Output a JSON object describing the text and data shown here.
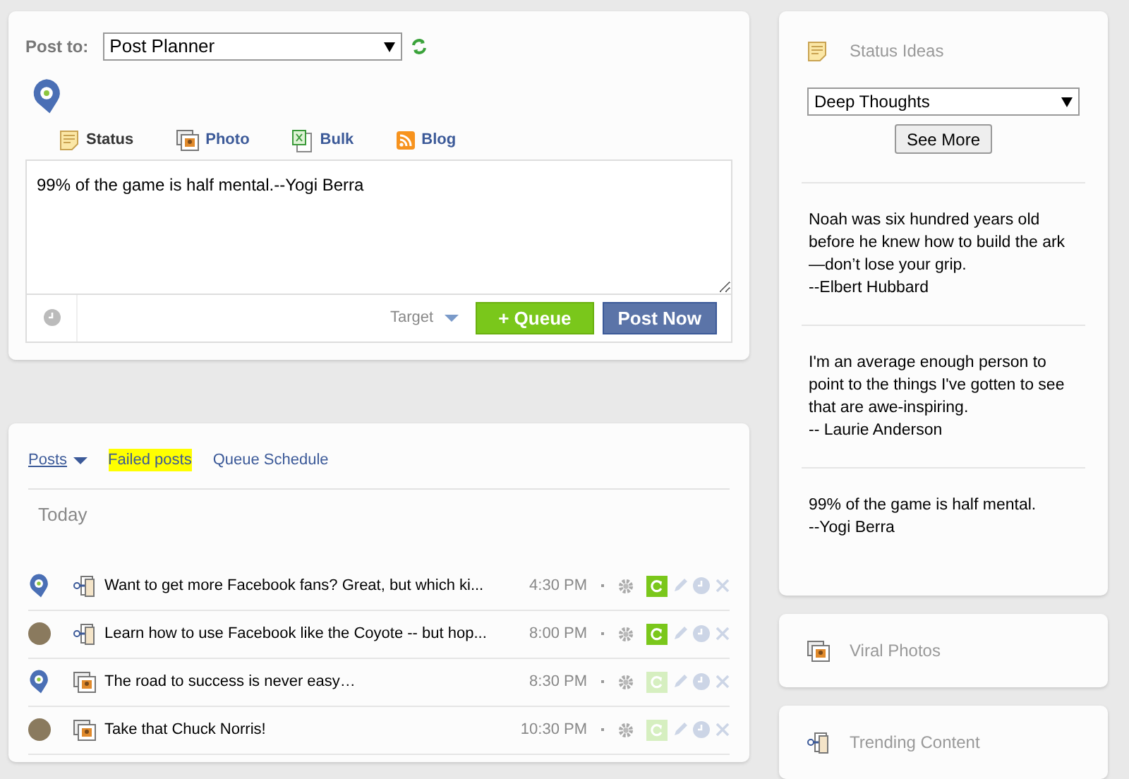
{
  "composer": {
    "post_to_label": "Post to:",
    "post_to_value": "Post Planner",
    "tabs": [
      {
        "label": "Status",
        "kind": "status",
        "selected": true
      },
      {
        "label": "Photo",
        "kind": "photo",
        "selected": false
      },
      {
        "label": "Bulk",
        "kind": "bulk",
        "selected": false
      },
      {
        "label": "Blog",
        "kind": "blog",
        "selected": false
      }
    ],
    "message": "99% of the game is half mental.--Yogi Berra",
    "target_label": "Target",
    "queue_button": "+ Queue",
    "post_now_button": "Post Now"
  },
  "posts": {
    "tabs": [
      {
        "label": "Posts",
        "kind": "dropdown",
        "selected": true
      },
      {
        "label": "Failed posts",
        "kind": "highlight",
        "selected": false
      },
      {
        "label": "Queue Schedule",
        "kind": "plain",
        "selected": false
      }
    ],
    "day": "Today",
    "rows": [
      {
        "logo_avatar": true,
        "kind": "link",
        "text": "Want to get more Facebook fans? Great, but which ki...",
        "time": "4:30 PM",
        "recycle_on": true
      },
      {
        "logo_avatar": false,
        "kind": "link",
        "text": "Learn how to use Facebook like the Coyote -- but hop...",
        "time": "8:00 PM",
        "recycle_on": true
      },
      {
        "logo_avatar": true,
        "kind": "photo",
        "text": "The road to success is never easy…",
        "time": "8:30 PM",
        "recycle_on": false
      },
      {
        "logo_avatar": false,
        "kind": "photo",
        "text": "Take that Chuck Norris!",
        "time": "10:30 PM",
        "recycle_on": false
      }
    ]
  },
  "sidebar": {
    "status_ideas": {
      "title": "Status Ideas",
      "category": "Deep Thoughts",
      "see_more_button": "See More",
      "quotes": [
        {
          "text": "Noah was six hundred years old before he knew how to build the ark—don’t lose your grip.",
          "author": "--Elbert Hubbard"
        },
        {
          "text": "I'm an average enough person to point to the things I've gotten to see that are awe-inspiring.",
          "author": "-- Laurie Anderson"
        },
        {
          "text": "99% of the game is half mental.",
          "author": "--Yogi Berra"
        }
      ]
    },
    "panels": [
      {
        "title": "Viral Photos",
        "kind": "photo"
      },
      {
        "title": "Trending Content",
        "kind": "link"
      }
    ]
  }
}
